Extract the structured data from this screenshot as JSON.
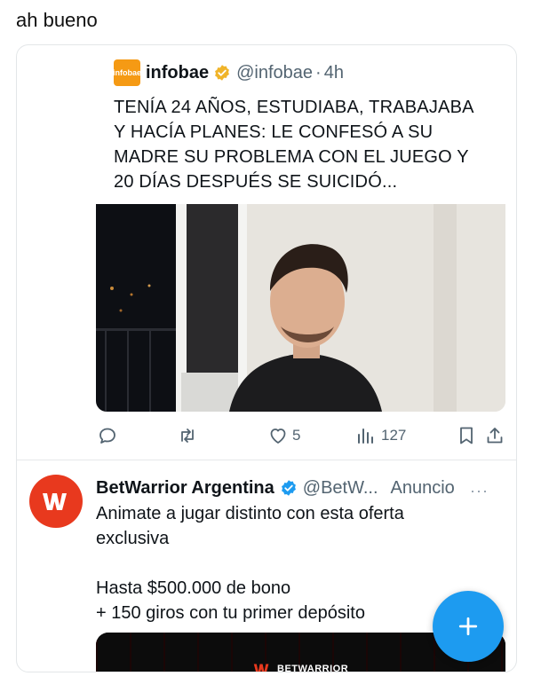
{
  "caption": "ah bueno",
  "quoted_post": {
    "logo_text": "infobae",
    "name": "infobae",
    "handle": "@infobae",
    "separator": "·",
    "time": "4h",
    "text_lines": [
      "TENÍA 24 AÑOS, ESTUDIABA, TRABAJABA",
      "Y HACÍA PLANES: LE CONFESÓ A SU",
      "MADRE SU PROBLEMA CON EL JUEGO Y",
      "20 DÍAS DESPUÉS SE SUICIDÓ..."
    ],
    "verified_color": "#f0b429",
    "logo_color": "#f59a14"
  },
  "actions": {
    "reply_count": "",
    "repost_count": "",
    "like_count": "5",
    "views_count": "127",
    "icons": [
      "reply-icon",
      "repost-icon",
      "like-icon",
      "views-icon",
      "bookmark-icon",
      "share-icon"
    ]
  },
  "ad": {
    "name": "BetWarrior Argentina",
    "handle": "@BetW...",
    "tag": "Anuncio",
    "more": "···",
    "text_lines": [
      "Animate a jugar distinto con esta oferta",
      "exclusiva",
      "",
      "Hasta $500.000 de bono",
      "+ 150 giros con tu primer depósito"
    ],
    "media_brand": "BETWARRIOR",
    "avatar_color": "#e8391e",
    "verified_color": "#1d9bf0"
  },
  "fab": {
    "icon": "plus-icon",
    "color": "#1d9bf0"
  }
}
